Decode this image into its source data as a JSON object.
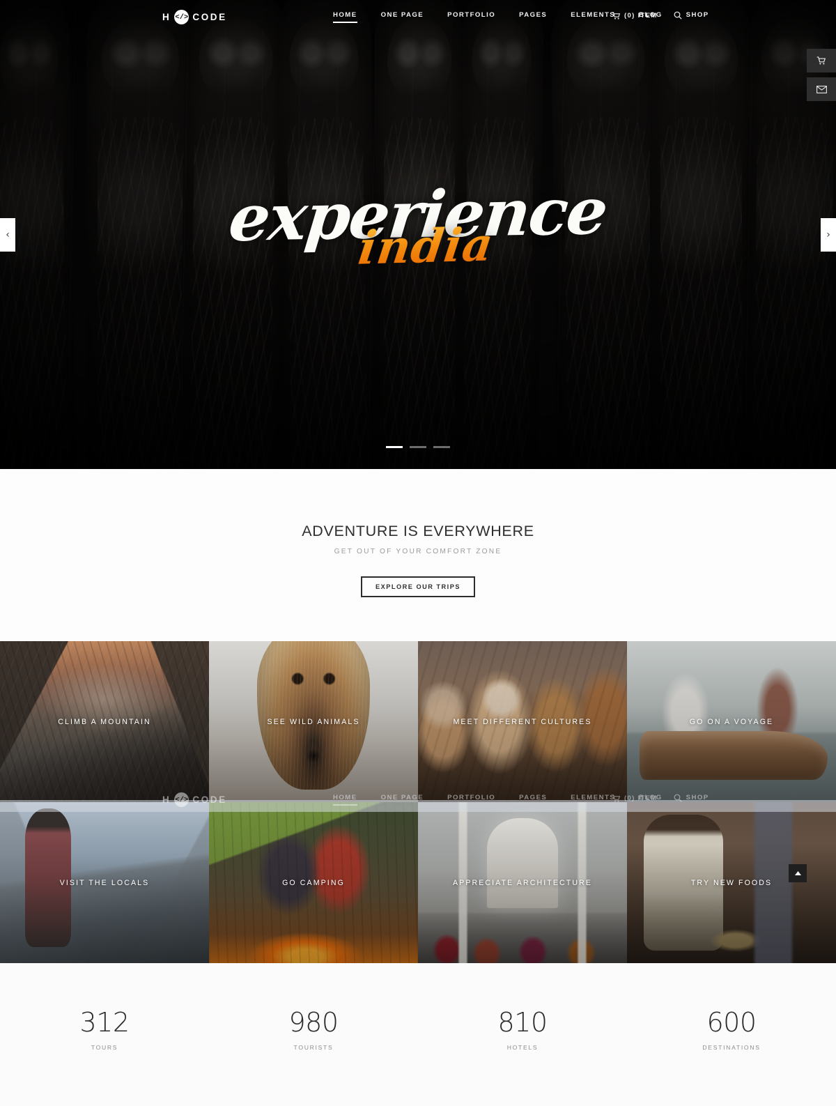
{
  "header": {
    "logo": {
      "pre": "H",
      "mark": "</>",
      "post": "CODE",
      "name": "H CODE"
    },
    "nav": [
      {
        "label": "HOME",
        "active": true
      },
      {
        "label": "ONE PAGE",
        "active": false
      },
      {
        "label": "PORTFOLIO",
        "active": false
      },
      {
        "label": "PAGES",
        "active": false
      },
      {
        "label": "ELEMENTS",
        "active": false
      },
      {
        "label": "BLOG",
        "active": false
      },
      {
        "label": "SHOP",
        "active": false
      }
    ],
    "cart_label": "(0) ITEM",
    "cart_icon": "shopping-cart-icon",
    "search_icon": "search-icon"
  },
  "hero": {
    "title_main": "experience",
    "title_accent": "india",
    "accent_color": "#f59312",
    "prev_label": "‹",
    "next_label": "›",
    "slides": [
      {
        "active": true
      },
      {
        "active": false
      },
      {
        "active": false
      }
    ]
  },
  "side_buttons": [
    {
      "icon": "shopping-cart-icon",
      "name": "cart-float-button"
    },
    {
      "icon": "envelope-icon",
      "name": "mail-float-button"
    }
  ],
  "intro": {
    "heading": "ADVENTURE IS EVERYWHERE",
    "subheading": "GET OUT OF YOUR COMFORT ZONE",
    "button": "EXPLORE OUR TRIPS"
  },
  "grid": {
    "tiles": [
      {
        "caption": "CLIMB A MOUNTAIN",
        "art": "ph-mountain",
        "key": "climb-a-mountain"
      },
      {
        "caption": "SEE WILD ANIMALS",
        "art": "ph-fox",
        "key": "see-wild-animals"
      },
      {
        "caption": "MEET DIFFERENT CULTURES",
        "art": "ph-monks",
        "key": "meet-different-cultures"
      },
      {
        "caption": "GO ON A VOYAGE",
        "art": "ph-boat",
        "key": "go-on-a-voyage"
      },
      {
        "caption": "VISIT THE LOCALS",
        "art": "ph-cyclist",
        "key": "visit-the-locals"
      },
      {
        "caption": "GO CAMPING",
        "art": "ph-camp",
        "key": "go-camping"
      },
      {
        "caption": "APPRECIATE ARCHITECTURE",
        "art": "ph-taj",
        "key": "appreciate-architecture"
      },
      {
        "caption": "TRY NEW FOODS",
        "art": "ph-food",
        "key": "try-new-foods"
      }
    ]
  },
  "scroll_top": {
    "icon": "chevron-up-icon"
  },
  "stats": [
    {
      "value": "312",
      "label": "TOURS"
    },
    {
      "value": "980",
      "label": "TOURISTS"
    },
    {
      "value": "810",
      "label": "HOTELS"
    },
    {
      "value": "600",
      "label": "DESTINATIONS"
    }
  ]
}
